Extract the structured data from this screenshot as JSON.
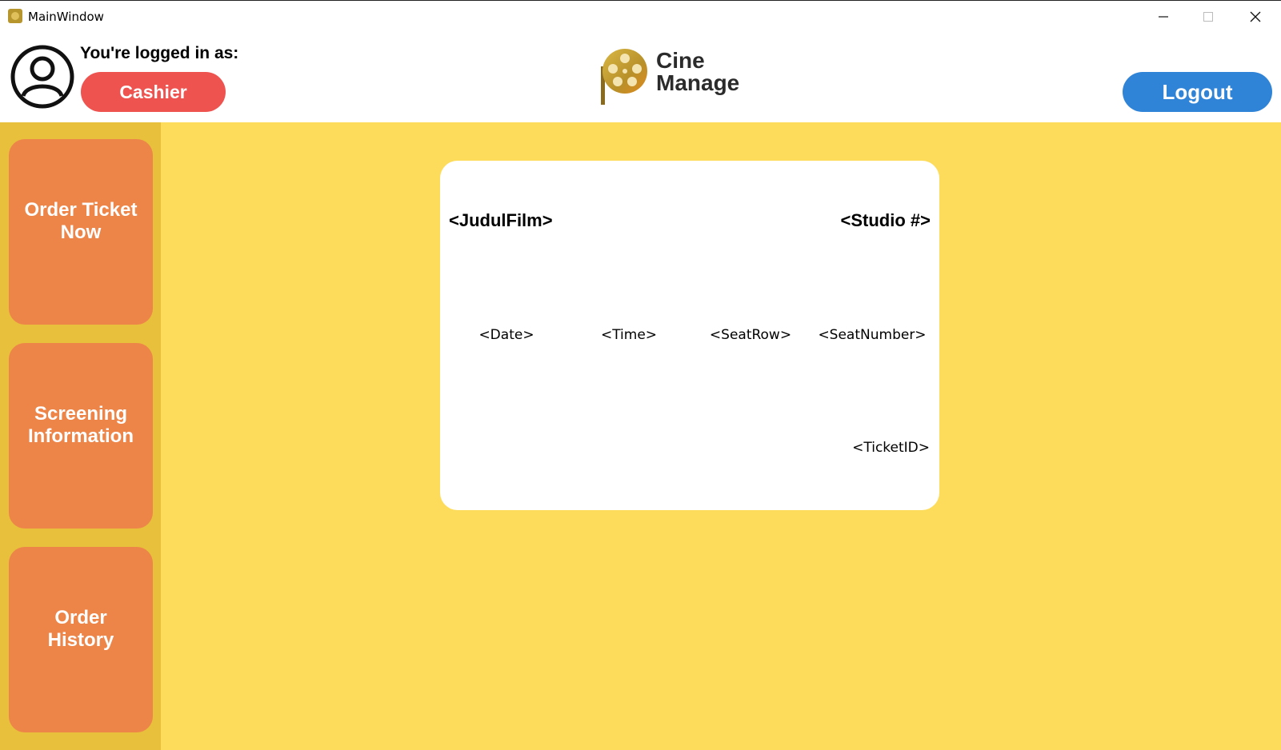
{
  "window": {
    "title": "MainWindow",
    "minimize_glyph": "─",
    "maximize_glyph": "☐",
    "close_glyph": "✕"
  },
  "header": {
    "logged_in_label": "You're logged in as:",
    "role": "Cashier",
    "logo_line1": "Cine",
    "logo_line2": "Manage",
    "logout_label": "Logout",
    "colors": {
      "role_badge": "#ef5350",
      "logout_button": "#2f84d8"
    }
  },
  "sidebar": {
    "items": [
      {
        "line1": "Order Ticket",
        "line2": "Now"
      },
      {
        "line1": "Screening",
        "line2": "Information"
      },
      {
        "line1": "Order",
        "line2": "History"
      }
    ],
    "colors": {
      "background": "#e9c03c",
      "button": "#ed8549"
    }
  },
  "ticket": {
    "film_title": "<JudulFilm>",
    "studio": "<Studio #>",
    "date": "<Date>",
    "time": "<Time>",
    "seat_row": "<SeatRow>",
    "seat_number": "<SeatNumber>",
    "ticket_id": "<TicketID>"
  },
  "colors": {
    "main_background": "#fddc5c",
    "card_background": "#ffffff"
  },
  "icons": {
    "app": "app-logo-icon",
    "user": "user-avatar-icon",
    "logo": "film-reel-logo-icon"
  }
}
